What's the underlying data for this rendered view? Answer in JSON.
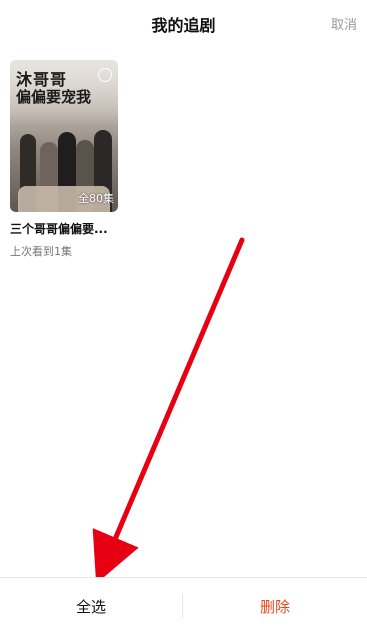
{
  "header": {
    "title": "我的追剧",
    "cancel_label": "取消"
  },
  "items": [
    {
      "poster_logo_line1": "沐哥哥",
      "poster_logo_line2": "偏偏要宠我",
      "episode_badge": "全80集",
      "title": "三个哥哥偏偏要...",
      "progress": "上次看到1集",
      "selected": false
    }
  ],
  "bottom": {
    "select_all_label": "全选",
    "delete_label": "删除"
  },
  "colors": {
    "delete_text": "#e64a19",
    "cancel_text": "#9a9a9a",
    "annotation_arrow": "#e60012"
  },
  "annotation": {
    "type": "arrow",
    "points_to": "select-all-button"
  }
}
